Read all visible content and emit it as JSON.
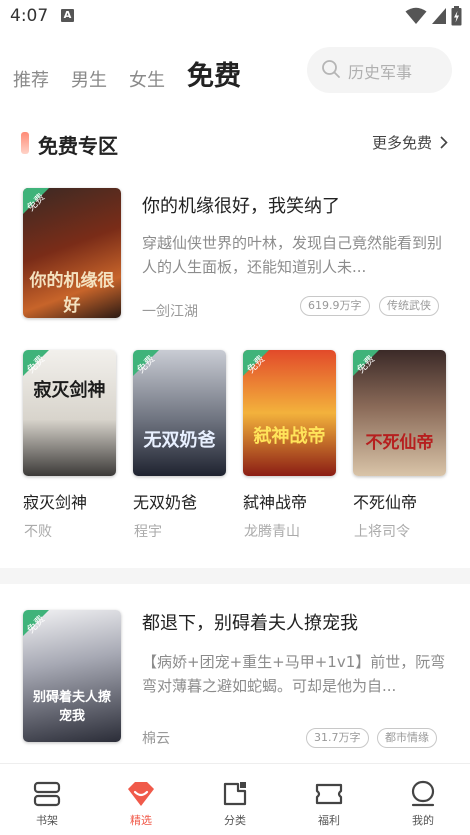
{
  "status_bar": {
    "time": "4:07",
    "notif": "A"
  },
  "top_tabs": [
    {
      "label": "推荐",
      "active": false
    },
    {
      "label": "男生",
      "active": false
    },
    {
      "label": "女生",
      "active": false
    },
    {
      "label": "免费",
      "active": true
    }
  ],
  "search": {
    "placeholder": "历史军事"
  },
  "section": {
    "title": "免费专区",
    "more": "更多免费"
  },
  "badge_label": "免费",
  "featured": {
    "title": "你的机缘很好，我笑纳了",
    "desc": "穿越仙侠世界的叶林，发现自己竟然能看到别人的人生面板，还能知道别人未...",
    "author": "一剑江湖",
    "tags": [
      "619.9万字",
      "传统武侠"
    ],
    "cover_text": "你的机缘很好"
  },
  "grid": [
    {
      "title": "寂灭剑神",
      "author": "不败",
      "cover_text": "寂灭剑神"
    },
    {
      "title": "无双奶爸",
      "author": "程宇",
      "cover_text": "无双奶爸"
    },
    {
      "title": "弑神战帝",
      "author": "龙腾青山",
      "cover_text": "弑神战帝"
    },
    {
      "title": "不死仙帝",
      "author": "上将司令",
      "cover_text": "不死仙帝"
    }
  ],
  "second": {
    "title": "都退下，别碍着夫人撩宠我",
    "desc": "【病娇+团宠+重生+马甲+1v1】前世，阮弯弯对薄暮之避如蛇蝎。可却是他为自...",
    "author": "棉云",
    "tags": [
      "31.7万字",
      "都市情缘"
    ],
    "cover_text": "别碍着夫人撩宠我"
  },
  "bottom_nav": [
    {
      "label": "书架",
      "icon": "bookshelf-icon",
      "active": false
    },
    {
      "label": "精选",
      "icon": "featured-icon",
      "active": true
    },
    {
      "label": "分类",
      "icon": "category-icon",
      "active": false
    },
    {
      "label": "福利",
      "icon": "ticket-icon",
      "active": false
    },
    {
      "label": "我的",
      "icon": "profile-icon",
      "active": false
    }
  ],
  "colors": {
    "accent": "#f05a4a",
    "badge": "#3fb37a"
  }
}
